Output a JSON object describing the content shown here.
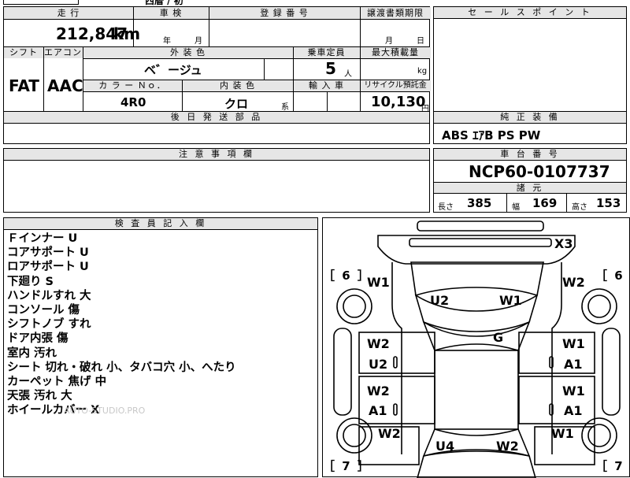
{
  "top_fragment": "西暦 / 初",
  "mileage": {
    "header": "走 行",
    "value": "212,847",
    "unit": "km"
  },
  "inspection": {
    "header": "車 検",
    "year": "年",
    "month": "月"
  },
  "registration": {
    "header": "登 録 番 号",
    "value": ""
  },
  "transfer_docs": {
    "header": "譲渡書類期限",
    "month": "月",
    "day": "日"
  },
  "sales_point": {
    "header": "セ ー ル ス ポ イ ン ト",
    "value": ""
  },
  "shift": {
    "header": "シフト",
    "value": "FAT"
  },
  "aircon": {
    "header": "エアコン",
    "value": "AAC"
  },
  "exterior_color": {
    "header": "外 装 色",
    "value": "ベ゛ージュ"
  },
  "capacity": {
    "header": "乗車定員",
    "value": "5",
    "unit": "人"
  },
  "max_load": {
    "header": "最大積載量",
    "value": "",
    "unit": "kg"
  },
  "color_no": {
    "header": "カ ラ ー Ｎｏ．",
    "value": "4R0"
  },
  "interior_color": {
    "header": "内 装 色",
    "value": "クロ",
    "suffix": "系"
  },
  "import": {
    "header": "輸 入 車"
  },
  "recycle": {
    "header": "リサイクル預託金",
    "value": "10,130",
    "unit": "円"
  },
  "later_parts": {
    "header": "後 日 発 送 部 品"
  },
  "genuine_equipment": {
    "header": "純 正 装 備",
    "value": "ABS ｴｱB PS PW"
  },
  "caution": {
    "header": "注 意 事 項 欄"
  },
  "chassis": {
    "header": "車 台 番 号",
    "value": "NCP60-0107737"
  },
  "specs": {
    "header": "諸 元",
    "length_label": "長さ",
    "length": "385",
    "width_label": "幅",
    "width": "169",
    "height_label": "高さ",
    "height": "153"
  },
  "inspector": {
    "header": "検 査 員 記 入 欄",
    "notes": [
      "Ｆインナー U",
      "コアサポート U",
      "ロアサポート U",
      "下廻り S",
      "ハンドルすれ 大",
      "コンソール 傷",
      "シフトノブ すれ",
      "ドア内張 傷",
      "室内 汚れ",
      "シート 切れ・破れ 小、タバコ穴 小、へたり",
      "カーペット 焦げ 中",
      "天張 汚れ 大",
      "ホイールカバー X"
    ]
  },
  "watermark": "AUTO-STUDIO.PRO",
  "diagram": {
    "tire_front_left": "［ 6 ］",
    "tire_front_right": "［ 6 ］",
    "tire_rear_left": "［ 7 ］",
    "tire_rear_right": "［ 7 ］",
    "bumper_front": "X3",
    "fender_fl": "W1",
    "fender_fr": "W2",
    "hood_left": "U2",
    "hood_right": "W1",
    "roof": "G",
    "door_fl_top": "W2",
    "door_fl_bottom": "U2",
    "door_fr_top": "W1",
    "door_fr_bottom": "A1",
    "door_rl_top": "W2",
    "door_rl_bottom": "A1",
    "door_rr_top": "W1",
    "door_rr_bottom": "A1",
    "quarter_rl": "W2",
    "quarter_rr": "W1",
    "trunk_left": "U4",
    "trunk_right": "W2"
  }
}
